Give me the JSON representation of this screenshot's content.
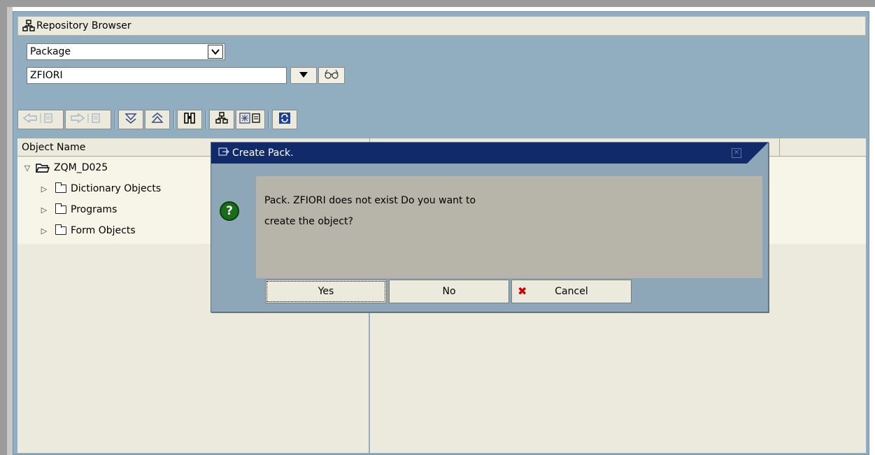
{
  "window": {
    "title": "Repository Browser"
  },
  "selector": {
    "object_type": "Package",
    "package_value": "ZFIORI"
  },
  "tree": {
    "header": "Object Name",
    "root": "ZQM_D025",
    "children": [
      "Dictionary Objects",
      "Programs",
      "Form Objects"
    ]
  },
  "dialog": {
    "title": "Create Pack.",
    "message_line1": "Pack. ZFIORI does not exist Do you want to",
    "message_line2": "create the object?",
    "buttons": {
      "yes": "Yes",
      "no": "No",
      "cancel": "Cancel"
    }
  },
  "colors": {
    "panel_bg": "#91adc0",
    "dialog_title_bg": "#112a6a",
    "dialog_body_bg": "#b7b5a9",
    "question_icon": "#1a6e1a",
    "cancel_icon": "#cc0000"
  },
  "icons": {
    "window": "hierarchy-icon",
    "dropdown": "chevron-down-icon",
    "input_help": "glasses-icon",
    "question": "question-icon",
    "cancel": "close-x-icon"
  }
}
